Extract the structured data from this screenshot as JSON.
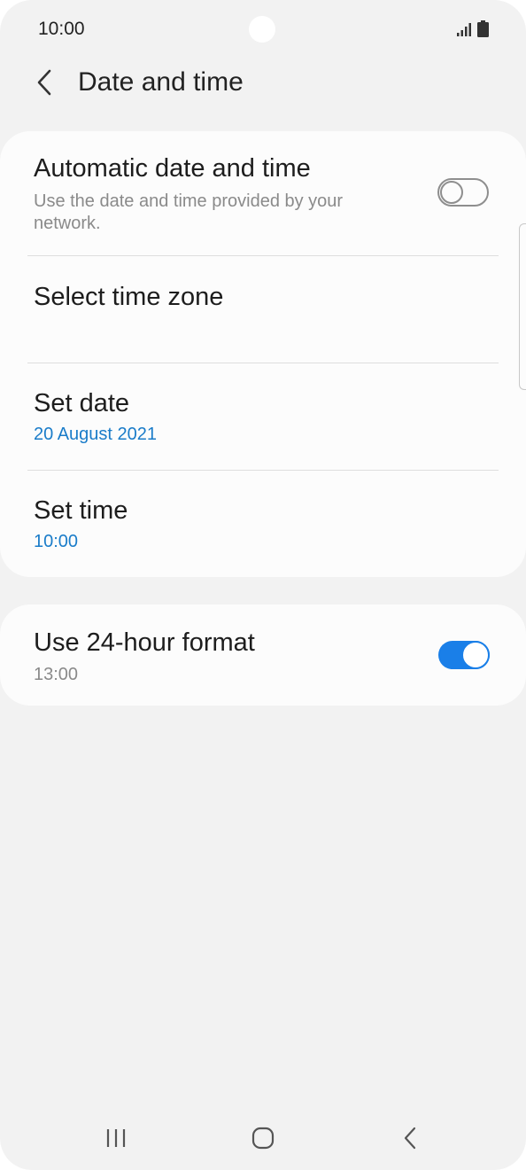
{
  "status_bar": {
    "time": "10:00"
  },
  "header": {
    "title": "Date and time"
  },
  "settings": {
    "automatic": {
      "title": "Automatic date and time",
      "subtitle": "Use the date and time provided by your network.",
      "enabled": false
    },
    "time_zone": {
      "title": "Select time zone"
    },
    "set_date": {
      "title": "Set date",
      "value": "20 August 2021"
    },
    "set_time": {
      "title": "Set time",
      "value": "10:00"
    },
    "format_24h": {
      "title": "Use 24-hour format",
      "value": "13:00",
      "enabled": true
    }
  },
  "colors": {
    "accent": "#1a7fe8",
    "value_text": "#1a7cc9",
    "background": "#f2f2f2",
    "card": "#fcfcfc"
  },
  "icons": [
    "signal-icon",
    "battery-icon",
    "back-arrow-icon",
    "recent-apps-icon",
    "home-icon",
    "nav-back-icon"
  ]
}
